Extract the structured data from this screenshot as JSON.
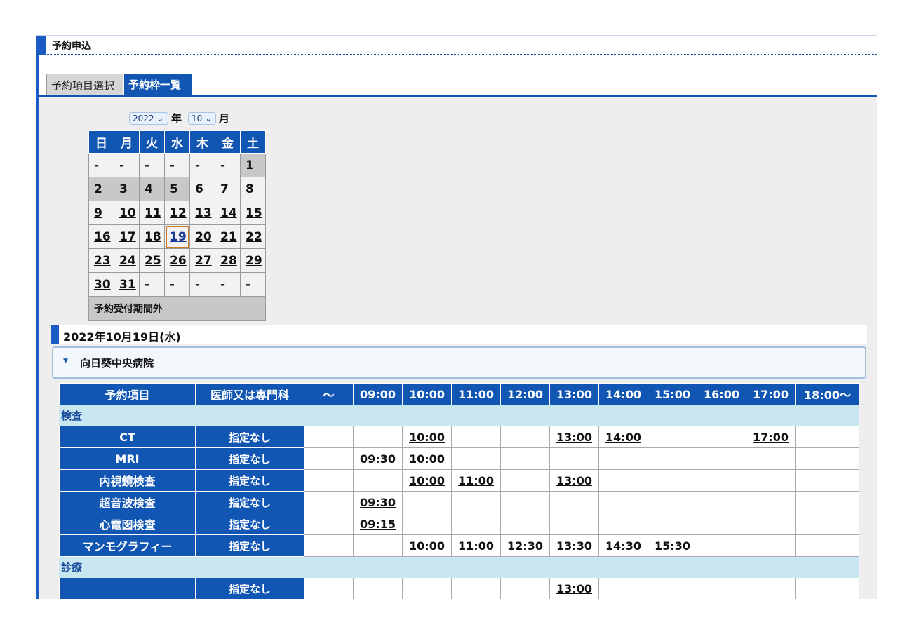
{
  "section": {
    "title": "予約申込"
  },
  "tabs": [
    {
      "label": "予約項目選択"
    },
    {
      "label": "予約枠一覧"
    }
  ],
  "selector": {
    "year": "2022",
    "year_unit": "年",
    "month": "10",
    "month_unit": "月"
  },
  "calendar": {
    "weekdays": [
      "日",
      "月",
      "火",
      "水",
      "木",
      "金",
      "土"
    ],
    "weeks": [
      [
        "-",
        "-",
        "-",
        "-",
        "-",
        "-",
        "1"
      ],
      [
        "2",
        "3",
        "4",
        "5",
        "6",
        "7",
        "8"
      ],
      [
        "9",
        "10",
        "11",
        "12",
        "13",
        "14",
        "15"
      ],
      [
        "16",
        "17",
        "18",
        "19",
        "20",
        "21",
        "22"
      ],
      [
        "23",
        "24",
        "25",
        "26",
        "27",
        "28",
        "29"
      ],
      [
        "30",
        "31",
        "-",
        "-",
        "-",
        "-",
        "-"
      ]
    ],
    "footer": "予約受付期間外"
  },
  "date_header": "2022年10月19日(水)",
  "hospital": {
    "caret": "▼",
    "name": "向日葵中央病院"
  },
  "table": {
    "headers": [
      "予約項目",
      "医師又は専門科",
      "～",
      "09:00",
      "10:00",
      "11:00",
      "12:00",
      "13:00",
      "14:00",
      "15:00",
      "16:00",
      "17:00",
      "18:00～"
    ],
    "categories": [
      {
        "name": "検査",
        "rows": [
          {
            "item": "CT",
            "doctor": "指定なし",
            "slots": [
              "",
              "",
              "10:00",
              "",
              "",
              "13:00",
              "14:00",
              "",
              "",
              "17:00",
              ""
            ]
          },
          {
            "item": "MRI",
            "doctor": "指定なし",
            "slots": [
              "",
              "09:30",
              "10:00",
              "",
              "",
              "",
              "",
              "",
              "",
              "",
              ""
            ]
          },
          {
            "item": "内視鏡検査",
            "doctor": "指定なし",
            "slots": [
              "",
              "",
              "10:00",
              "11:00",
              "",
              "13:00",
              "",
              "",
              "",
              "",
              ""
            ]
          },
          {
            "item": "超音波検査",
            "doctor": "指定なし",
            "slots": [
              "",
              "09:30",
              "",
              "",
              "",
              "",
              "",
              "",
              "",
              "",
              ""
            ]
          },
          {
            "item": "心電図検査",
            "doctor": "指定なし",
            "slots": [
              "",
              "09:15",
              "",
              "",
              "",
              "",
              "",
              "",
              "",
              "",
              ""
            ]
          },
          {
            "item": "マンモグラフィー",
            "doctor": "指定なし",
            "slots": [
              "",
              "",
              "10:00",
              "11:00",
              "12:30",
              "13:30",
              "14:30",
              "15:30",
              "",
              "",
              ""
            ]
          }
        ]
      },
      {
        "name": "診療",
        "rows": [
          {
            "item": "",
            "doctor": "指定なし",
            "slots": [
              "",
              "",
              "",
              "",
              "",
              "13:00",
              "",
              "",
              "",
              "",
              ""
            ]
          }
        ]
      }
    ]
  }
}
